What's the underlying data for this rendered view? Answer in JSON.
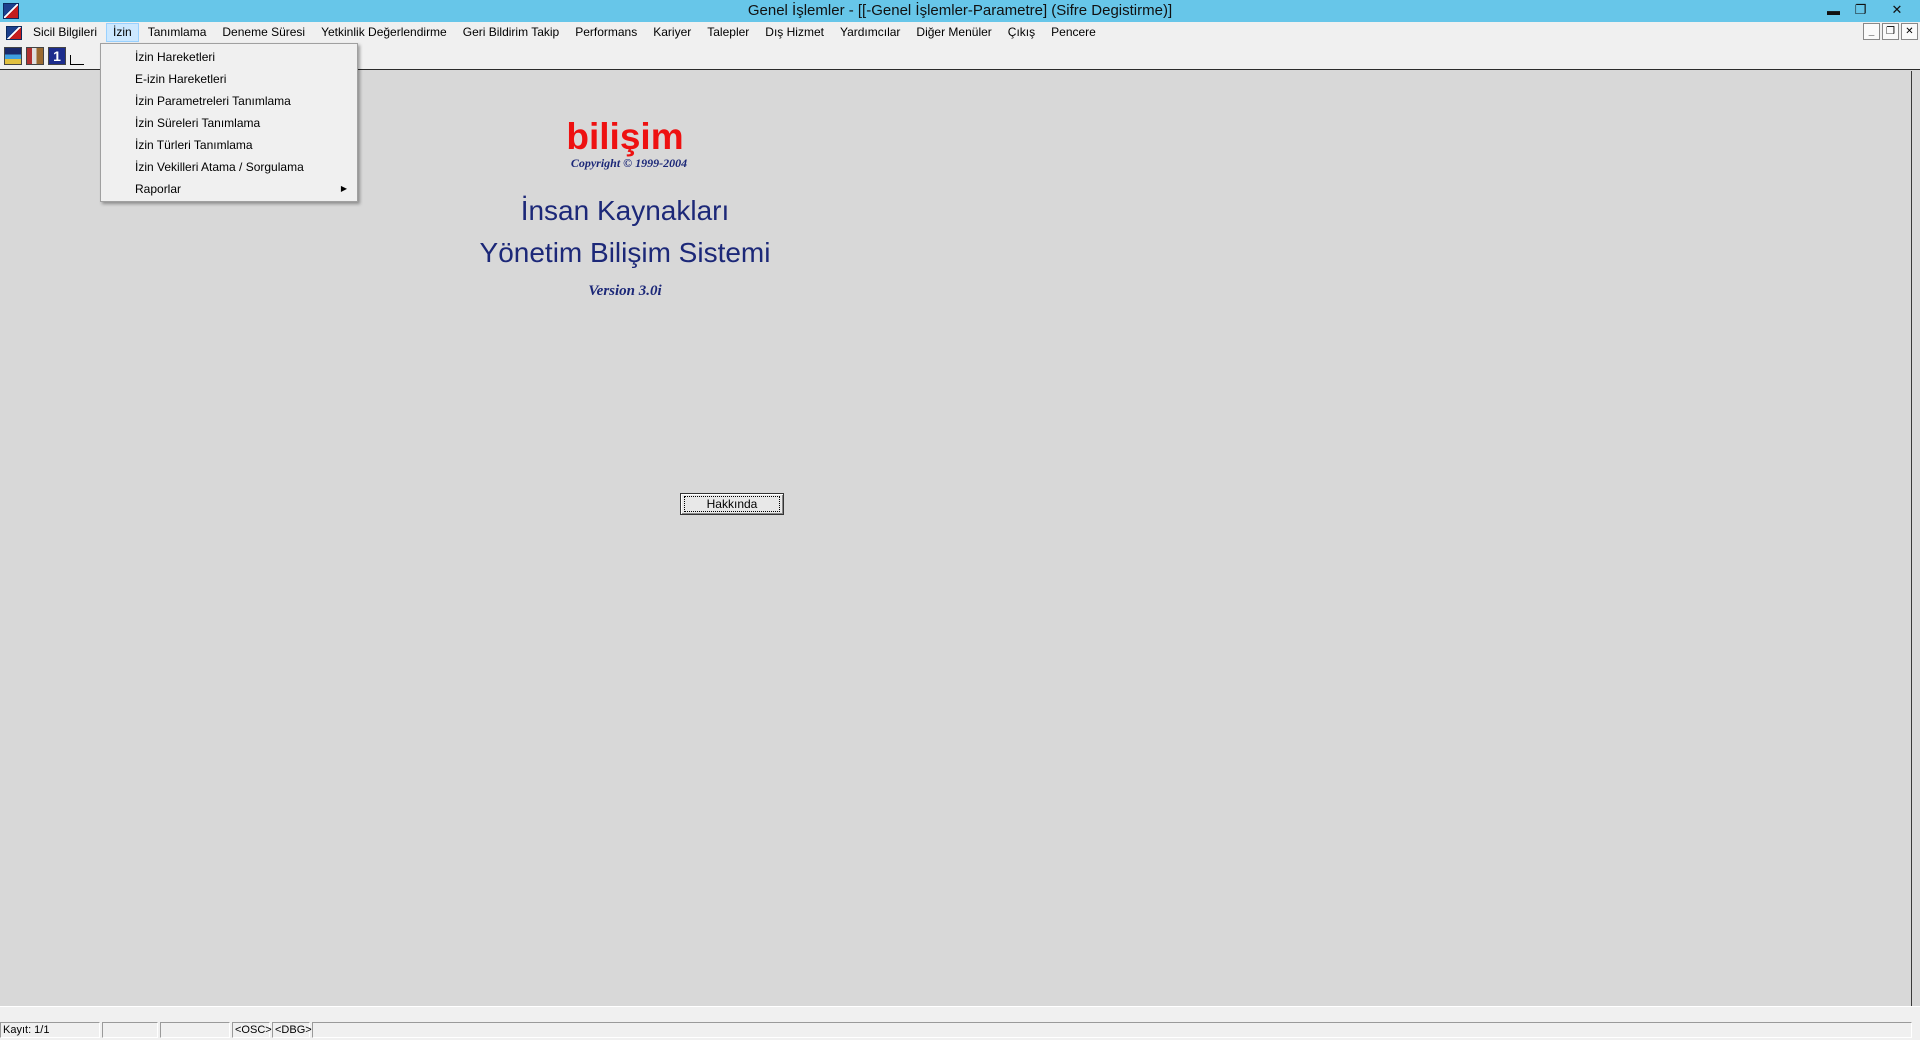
{
  "window": {
    "title": "Genel İşlemler - [[-Genel İşlemler-Parametre] (Sifre Degistirme)]",
    "minimize_glyph": "▬",
    "restore_glyph": "❐",
    "close_glyph": "✕"
  },
  "menubar": {
    "items": [
      "Sicil Bilgileri",
      "İzin",
      "Tanımlama",
      "Deneme Süresi",
      "Yetkinlik Değerlendirme",
      "Geri Bildirim Takip",
      "Performans",
      "Kariyer",
      "Talepler",
      "Dış Hizmet",
      "Yardımcılar",
      "Diğer Menüler",
      "Çıkış",
      "Pencere"
    ],
    "active_index": 1,
    "mdi_minimize_glyph": "_",
    "mdi_restore_glyph": "❐",
    "mdi_close_glyph": "✕"
  },
  "toolbar": {
    "icons": [
      "report-icon",
      "books-icon",
      "info-icon",
      "line-icon"
    ],
    "info_glyph": "1"
  },
  "dropdown": {
    "items": [
      "İzin Hareketleri",
      "E-izin Hareketleri",
      "İzin Parametreleri Tanımlama",
      "İzin Süreleri Tanımlama",
      "İzin Türleri Tanımlama",
      "İzin Vekilleri Atama / Sorgulama",
      "Raporlar"
    ],
    "submenu_arrow": "▶"
  },
  "splash": {
    "brand": "bilişim",
    "copyright": "Copyright © 1999-2004",
    "product_line1": "İnsan Kaynakları",
    "product_line2": "Yönetim Bilişim Sistemi",
    "version": "Version 3.0i",
    "brand_color": "#ee1111",
    "text_color": "#1c2878"
  },
  "about_button": {
    "label": "Hakkında"
  },
  "statusbar": {
    "record": "Kayıt: 1/1",
    "osc": "<OSC>",
    "dbg": "<DBG>"
  }
}
